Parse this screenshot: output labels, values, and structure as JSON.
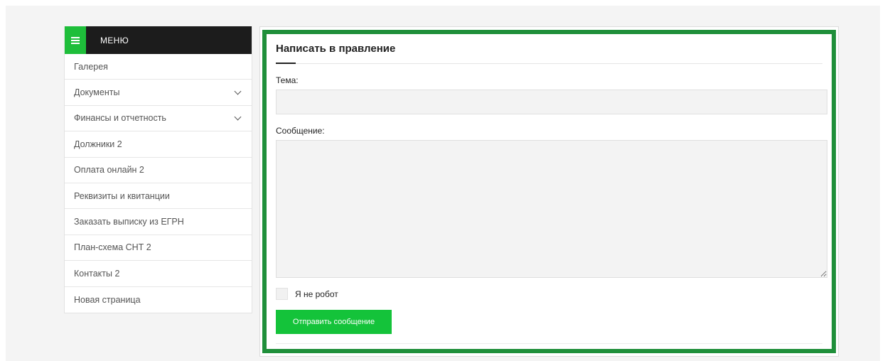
{
  "sidebar": {
    "menu_title": "МЕНЮ",
    "items": [
      {
        "label": "Галерея",
        "has_submenu": false
      },
      {
        "label": "Документы",
        "has_submenu": true
      },
      {
        "label": "Финансы и отчетность",
        "has_submenu": true
      },
      {
        "label": "Должники 2",
        "has_submenu": false
      },
      {
        "label": "Оплата онлайн 2",
        "has_submenu": false
      },
      {
        "label": "Реквизиты и квитанции",
        "has_submenu": false
      },
      {
        "label": "Заказать выписку из ЕГРН",
        "has_submenu": false
      },
      {
        "label": "План-схема СНТ 2",
        "has_submenu": false
      },
      {
        "label": "Контакты 2",
        "has_submenu": false
      },
      {
        "label": "Новая страница",
        "has_submenu": false
      }
    ]
  },
  "form": {
    "title": "Написать в правление",
    "subject_label": "Тема:",
    "subject_value": "",
    "message_label": "Сообщение:",
    "message_value": "",
    "captcha_label": "Я не робот",
    "submit_label": "Отправить сообщение"
  },
  "colors": {
    "accent_green": "#14c33a",
    "panel_border": "#1f8f3a",
    "menu_header": "#1c1c1c"
  },
  "icons": {
    "menu_toggle": "hamburger-icon",
    "submenu": "chevron-down-icon"
  }
}
